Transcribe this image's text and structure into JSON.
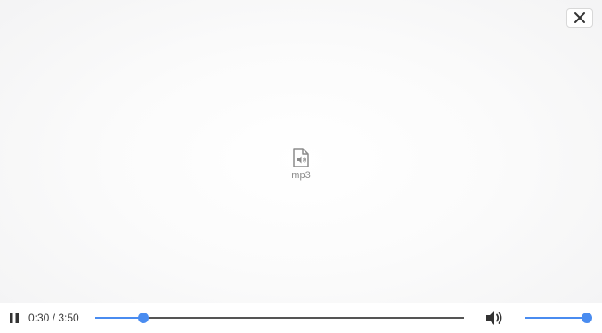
{
  "viewer": {
    "file_type_label": "mp3",
    "file_icon": "audio-file-icon",
    "close_icon": "close-icon"
  },
  "player": {
    "state": "playing",
    "play_pause_icon": "pause-icon",
    "time_display": "0:30 / 3:50",
    "current_seconds": 30,
    "duration_seconds": 230,
    "volume_icon": "speaker-icon",
    "volume_level": 1.0
  },
  "colors": {
    "accent": "#4a8cf0",
    "track": "#555555",
    "icon": "#333333"
  }
}
